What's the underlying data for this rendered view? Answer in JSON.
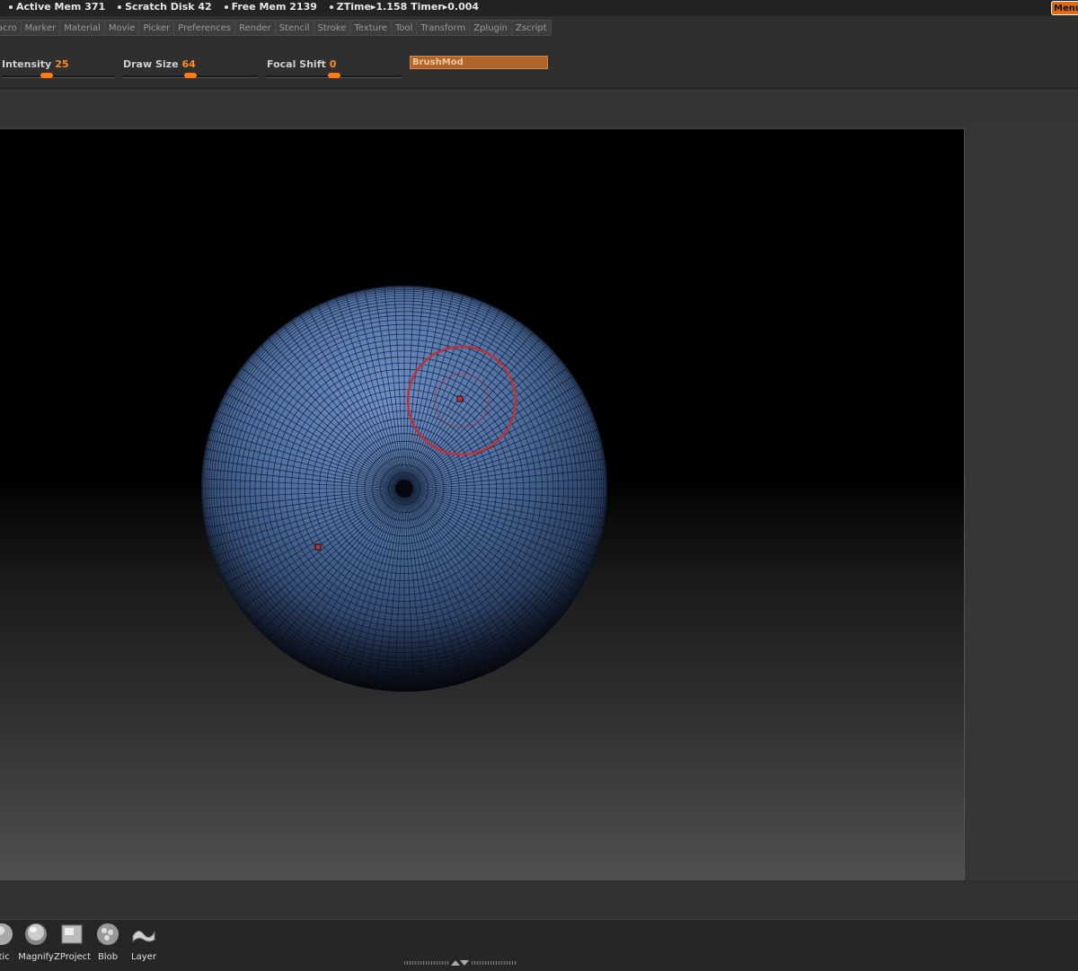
{
  "status": {
    "active_mem_label": "Active Mem",
    "active_mem": "371",
    "scratch_label": "Scratch Disk",
    "scratch": "42",
    "free_mem_label": "Free Mem",
    "free_mem": "2139",
    "ztime_label": "ZTime",
    "ztime": "1.158",
    "timer_label": "Timer",
    "timer": "0.004",
    "menu_label": "Menu"
  },
  "menus": [
    "acro",
    "Marker",
    "Material",
    "Movie",
    "Picker",
    "Preferences",
    "Render",
    "Stencil",
    "Stroke",
    "Texture",
    "Tool",
    "Transform",
    "Zplugin",
    "Zscript"
  ],
  "toolbar": {
    "intensity_label": "Intensity",
    "intensity_value": "25",
    "draw_size_label": "Draw Size",
    "draw_size_value": "64",
    "focal_shift_label": "Focal Shift",
    "focal_shift_value": "0",
    "brushmod_label": "BrushMod"
  },
  "brushes": [
    "stic",
    "Magnify",
    "ZProject",
    "Blob",
    "Layer"
  ],
  "colors": {
    "accent": "#ff7a10",
    "sphere": "#4c6d9e",
    "brush_cursor": "#c0303a"
  }
}
